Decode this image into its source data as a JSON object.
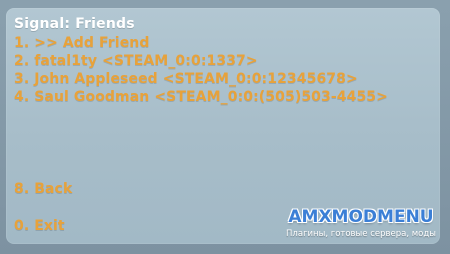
{
  "menu": {
    "title": "Signal: Friends",
    "items": [
      {
        "key": "1",
        "label": "1. >> Add Friend"
      },
      {
        "key": "2",
        "label": "2. fatal1ty <STEAM_0:0:1337>"
      },
      {
        "key": "3",
        "label": "3. John Appleseed <STEAM_0:0:12345678>"
      },
      {
        "key": "4",
        "label": "4. Saul Goodman <STEAM_0:0:(505)503-4455>"
      },
      {
        "key": "8",
        "label": "8. Back"
      },
      {
        "key": "0",
        "label": "0. Exit"
      }
    ]
  },
  "watermark": {
    "logo_text": "AMXMODMENU",
    "tagline": "Плагины, готовые сервера, моды"
  },
  "colors": {
    "title": "#ffffff",
    "item": "#e8a23a",
    "panel": "#a9bfcb",
    "logo": "#3b7fd6"
  }
}
